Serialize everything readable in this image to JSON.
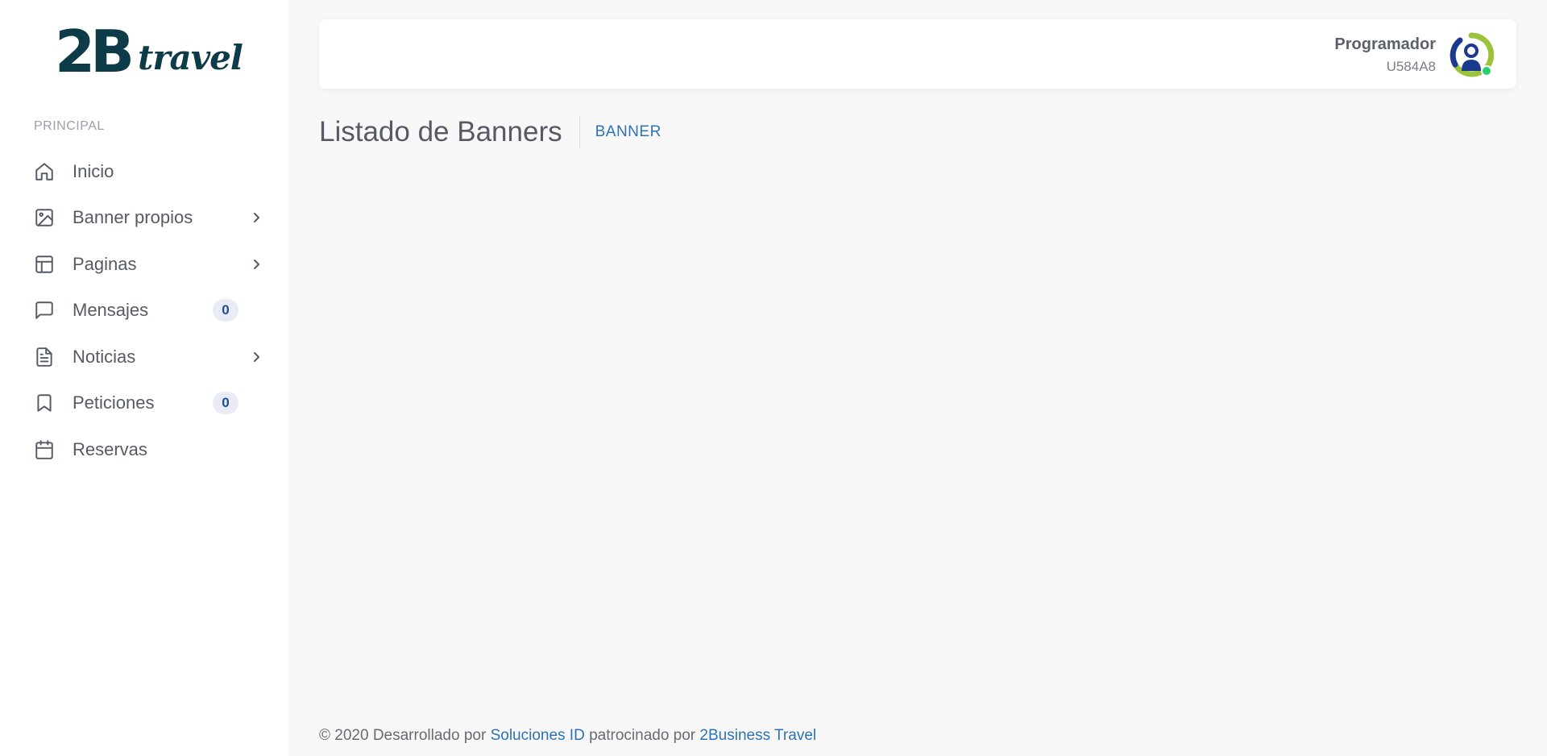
{
  "logo": {
    "main": "2B",
    "script": "travel"
  },
  "sidebar": {
    "section_title": "PRINCIPAL",
    "items": [
      {
        "label": "Inicio",
        "icon": "home-icon"
      },
      {
        "label": "Banner propios",
        "icon": "image-icon",
        "has_submenu": true
      },
      {
        "label": "Paginas",
        "icon": "layout-icon",
        "has_submenu": true
      },
      {
        "label": "Mensajes",
        "icon": "message-icon",
        "badge": "0"
      },
      {
        "label": "Noticias",
        "icon": "file-text-icon",
        "has_submenu": true
      },
      {
        "label": "Peticiones",
        "icon": "bookmark-icon",
        "badge": "0"
      },
      {
        "label": "Reservas",
        "icon": "calendar-icon"
      }
    ]
  },
  "header": {
    "user_name": "Programador",
    "user_code": "U584A8"
  },
  "page": {
    "title": "Listado de Banners",
    "breadcrumb": "BANNER"
  },
  "footer": {
    "prefix": "© 2020 Desarrollado por",
    "link1": "Soluciones ID",
    "middle": "patrocinado por",
    "link2": "2Business Travel"
  },
  "colors": {
    "brand": "#0e3b48",
    "link": "#2d72b7",
    "badge_bg": "#e9ecf6",
    "status_online": "#2ecc71"
  }
}
